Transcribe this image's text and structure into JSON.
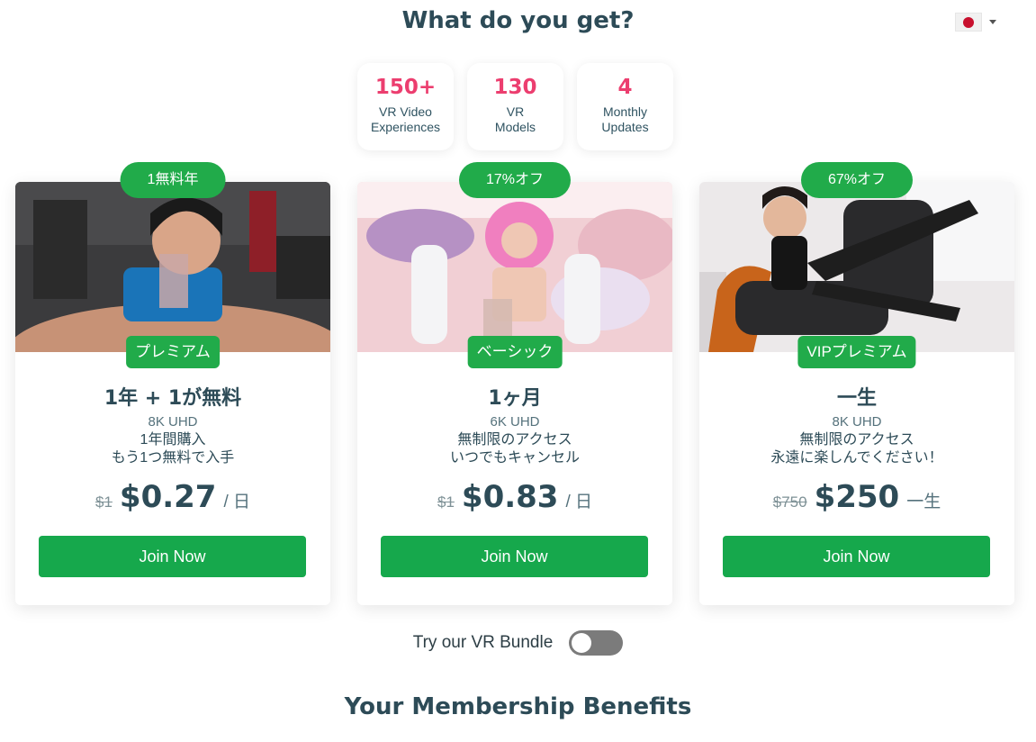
{
  "header": {
    "title": "What do you get?",
    "language_icon": "japan-flag-icon"
  },
  "stats": [
    {
      "value": "150+",
      "label_line1": "VR Video",
      "label_line2": "Experiences"
    },
    {
      "value": "130",
      "label_line1": "VR",
      "label_line2": "Models"
    },
    {
      "value": "4",
      "label_line1": "Monthly",
      "label_line2": "Updates"
    }
  ],
  "plans": [
    {
      "discount": "1無料年",
      "tier": "プレミアム",
      "title": "1年 + 1が無料",
      "quality": "8K UHD",
      "desc1": "1年間購入",
      "desc2": "もう1つ無料で入手",
      "old_price": "$1",
      "price": "$0.27",
      "period": "/ 日",
      "button": "Join Now"
    },
    {
      "discount": "17%オフ",
      "tier": "ベーシック",
      "title": "1ヶ月",
      "quality": "6K UHD",
      "desc1": "無制限のアクセス",
      "desc2": "いつでもキャンセル",
      "old_price": "$1",
      "price": "$0.83",
      "period": "/ 日",
      "button": "Join Now"
    },
    {
      "discount": "67%オフ",
      "tier": "VIPプレミアム",
      "title": "一生",
      "quality": "8K UHD",
      "desc1": "無制限のアクセス",
      "desc2": "永遠に楽しんでください！",
      "old_price": "$750",
      "price": "$250",
      "period": "一生",
      "button": "Join Now"
    }
  ],
  "bundle": {
    "label": "Try our VR Bundle",
    "enabled": false
  },
  "benefits": {
    "title": "Your Membership Benefits"
  },
  "colors": {
    "accent_green": "#16a84c",
    "stat_pink": "#ec3e6f",
    "heading": "#2d4b57"
  }
}
